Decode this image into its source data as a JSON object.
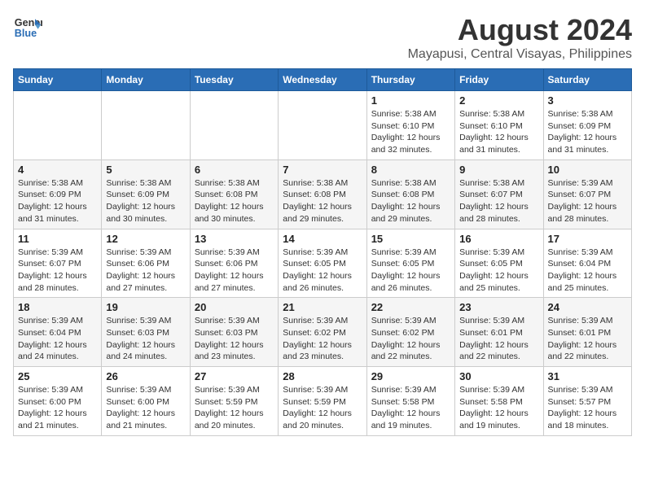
{
  "header": {
    "logo_line1": "General",
    "logo_line2": "Blue",
    "month_title": "August 2024",
    "location": "Mayapusi, Central Visayas, Philippines"
  },
  "weekdays": [
    "Sunday",
    "Monday",
    "Tuesday",
    "Wednesday",
    "Thursday",
    "Friday",
    "Saturday"
  ],
  "weeks": [
    [
      {
        "day": "",
        "info": ""
      },
      {
        "day": "",
        "info": ""
      },
      {
        "day": "",
        "info": ""
      },
      {
        "day": "",
        "info": ""
      },
      {
        "day": "1",
        "info": "Sunrise: 5:38 AM\nSunset: 6:10 PM\nDaylight: 12 hours\nand 32 minutes."
      },
      {
        "day": "2",
        "info": "Sunrise: 5:38 AM\nSunset: 6:10 PM\nDaylight: 12 hours\nand 31 minutes."
      },
      {
        "day": "3",
        "info": "Sunrise: 5:38 AM\nSunset: 6:09 PM\nDaylight: 12 hours\nand 31 minutes."
      }
    ],
    [
      {
        "day": "4",
        "info": "Sunrise: 5:38 AM\nSunset: 6:09 PM\nDaylight: 12 hours\nand 31 minutes."
      },
      {
        "day": "5",
        "info": "Sunrise: 5:38 AM\nSunset: 6:09 PM\nDaylight: 12 hours\nand 30 minutes."
      },
      {
        "day": "6",
        "info": "Sunrise: 5:38 AM\nSunset: 6:08 PM\nDaylight: 12 hours\nand 30 minutes."
      },
      {
        "day": "7",
        "info": "Sunrise: 5:38 AM\nSunset: 6:08 PM\nDaylight: 12 hours\nand 29 minutes."
      },
      {
        "day": "8",
        "info": "Sunrise: 5:38 AM\nSunset: 6:08 PM\nDaylight: 12 hours\nand 29 minutes."
      },
      {
        "day": "9",
        "info": "Sunrise: 5:38 AM\nSunset: 6:07 PM\nDaylight: 12 hours\nand 28 minutes."
      },
      {
        "day": "10",
        "info": "Sunrise: 5:39 AM\nSunset: 6:07 PM\nDaylight: 12 hours\nand 28 minutes."
      }
    ],
    [
      {
        "day": "11",
        "info": "Sunrise: 5:39 AM\nSunset: 6:07 PM\nDaylight: 12 hours\nand 28 minutes."
      },
      {
        "day": "12",
        "info": "Sunrise: 5:39 AM\nSunset: 6:06 PM\nDaylight: 12 hours\nand 27 minutes."
      },
      {
        "day": "13",
        "info": "Sunrise: 5:39 AM\nSunset: 6:06 PM\nDaylight: 12 hours\nand 27 minutes."
      },
      {
        "day": "14",
        "info": "Sunrise: 5:39 AM\nSunset: 6:05 PM\nDaylight: 12 hours\nand 26 minutes."
      },
      {
        "day": "15",
        "info": "Sunrise: 5:39 AM\nSunset: 6:05 PM\nDaylight: 12 hours\nand 26 minutes."
      },
      {
        "day": "16",
        "info": "Sunrise: 5:39 AM\nSunset: 6:05 PM\nDaylight: 12 hours\nand 25 minutes."
      },
      {
        "day": "17",
        "info": "Sunrise: 5:39 AM\nSunset: 6:04 PM\nDaylight: 12 hours\nand 25 minutes."
      }
    ],
    [
      {
        "day": "18",
        "info": "Sunrise: 5:39 AM\nSunset: 6:04 PM\nDaylight: 12 hours\nand 24 minutes."
      },
      {
        "day": "19",
        "info": "Sunrise: 5:39 AM\nSunset: 6:03 PM\nDaylight: 12 hours\nand 24 minutes."
      },
      {
        "day": "20",
        "info": "Sunrise: 5:39 AM\nSunset: 6:03 PM\nDaylight: 12 hours\nand 23 minutes."
      },
      {
        "day": "21",
        "info": "Sunrise: 5:39 AM\nSunset: 6:02 PM\nDaylight: 12 hours\nand 23 minutes."
      },
      {
        "day": "22",
        "info": "Sunrise: 5:39 AM\nSunset: 6:02 PM\nDaylight: 12 hours\nand 22 minutes."
      },
      {
        "day": "23",
        "info": "Sunrise: 5:39 AM\nSunset: 6:01 PM\nDaylight: 12 hours\nand 22 minutes."
      },
      {
        "day": "24",
        "info": "Sunrise: 5:39 AM\nSunset: 6:01 PM\nDaylight: 12 hours\nand 22 minutes."
      }
    ],
    [
      {
        "day": "25",
        "info": "Sunrise: 5:39 AM\nSunset: 6:00 PM\nDaylight: 12 hours\nand 21 minutes."
      },
      {
        "day": "26",
        "info": "Sunrise: 5:39 AM\nSunset: 6:00 PM\nDaylight: 12 hours\nand 21 minutes."
      },
      {
        "day": "27",
        "info": "Sunrise: 5:39 AM\nSunset: 5:59 PM\nDaylight: 12 hours\nand 20 minutes."
      },
      {
        "day": "28",
        "info": "Sunrise: 5:39 AM\nSunset: 5:59 PM\nDaylight: 12 hours\nand 20 minutes."
      },
      {
        "day": "29",
        "info": "Sunrise: 5:39 AM\nSunset: 5:58 PM\nDaylight: 12 hours\nand 19 minutes."
      },
      {
        "day": "30",
        "info": "Sunrise: 5:39 AM\nSunset: 5:58 PM\nDaylight: 12 hours\nand 19 minutes."
      },
      {
        "day": "31",
        "info": "Sunrise: 5:39 AM\nSunset: 5:57 PM\nDaylight: 12 hours\nand 18 minutes."
      }
    ]
  ]
}
